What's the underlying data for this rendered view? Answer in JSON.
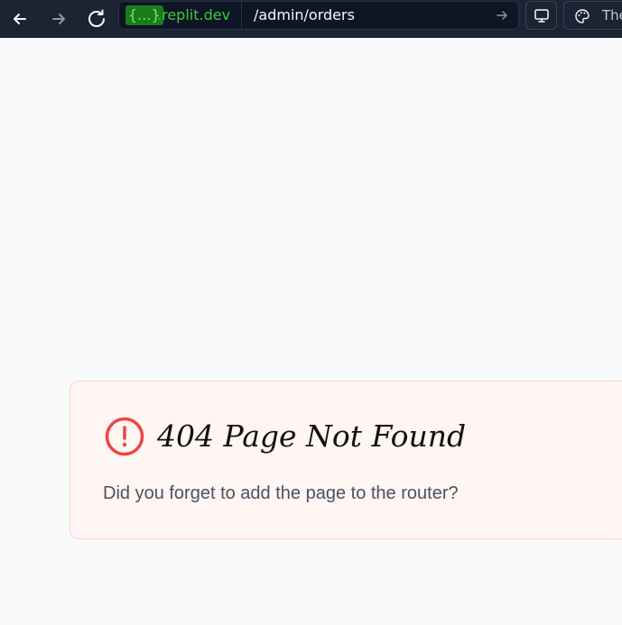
{
  "browser": {
    "nav": {
      "back_icon": "arrow-left-icon",
      "forward_icon": "arrow-right-icon",
      "reload_icon": "reload-icon"
    },
    "url": {
      "domain_badge": "{...}",
      "domain_suffix": ".replit.dev",
      "path": "/admin/orders",
      "go_icon": "arrow-right-icon"
    },
    "devices_icon": "monitor-icon",
    "theme": {
      "icon": "palette-icon",
      "label": "Theme"
    }
  },
  "page": {
    "error": {
      "icon": "alert-circle-icon",
      "title": "404 Page Not Found",
      "message": "Did you forget to add the page to the router?"
    }
  },
  "colors": {
    "toolbar_bg": "#1c2333",
    "url_bg": "#0e1525",
    "domain_green": "#3ec93e",
    "page_bg": "#f9fafb",
    "card_bg": "#fff5f3",
    "card_border": "#fdd3c8",
    "error_red": "#ef4444",
    "title_text": "#111111",
    "body_text": "#4b5160"
  }
}
